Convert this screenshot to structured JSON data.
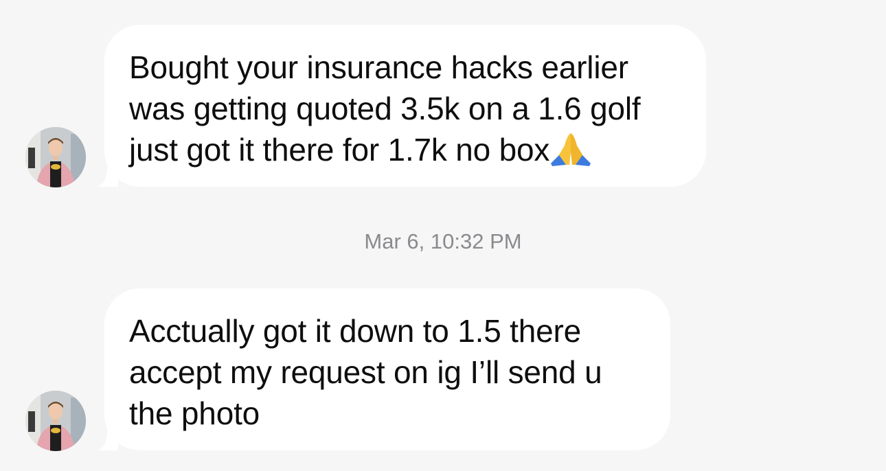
{
  "messages": [
    {
      "sender": "received",
      "lines": [
        "Bought your insurance hacks earlier",
        "was getting quoted 3.5k on a 1.6 golf",
        "just got it there for 1.7k no box"
      ],
      "emoji": "folded-hands"
    },
    {
      "sender": "received",
      "lines": [
        "Acctually got it down to 1.5 there",
        "accept my request on ig I’ll send u",
        "the photo"
      ]
    }
  ],
  "timestamp": "Mar 6, 10:32 PM",
  "colors": {
    "background": "#f6f6f6",
    "bubble": "#ffffff",
    "text": "#0e0e0e",
    "timestamp": "#8a8a8e"
  }
}
